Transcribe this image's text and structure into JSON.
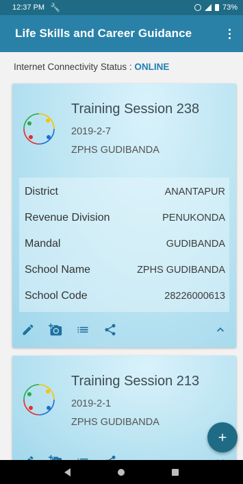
{
  "status": {
    "time": "12:37 PM",
    "battery": "73%"
  },
  "app": {
    "title": "Life Skills and Career Guidance"
  },
  "connectivity": {
    "label": "Internet Connectivity Status : ",
    "value": "ONLINE"
  },
  "sessions": [
    {
      "title": "Training Session 238",
      "date": "2019-2-7",
      "school": "ZPHS GUDIBANDA",
      "details": [
        {
          "label": "District",
          "value": "ANANTAPUR"
        },
        {
          "label": "Revenue Division",
          "value": "PENUKONDA"
        },
        {
          "label": "Mandal",
          "value": "GUDIBANDA"
        },
        {
          "label": "School Name",
          "value": "ZPHS GUDIBANDA"
        },
        {
          "label": "School Code",
          "value": "28226000613"
        }
      ]
    },
    {
      "title": "Training Session 213",
      "date": "2019-2-1",
      "school": "ZPHS GUDIBANDA"
    }
  ],
  "colors": {
    "primary": "#2981a7",
    "status_bar": "#1f6b86",
    "accent": "#1f6fa0"
  },
  "icons": [
    "edit-icon",
    "add-photo-icon",
    "list-icon",
    "share-icon",
    "chevron-up-icon",
    "chevron-down-icon",
    "add-icon"
  ]
}
